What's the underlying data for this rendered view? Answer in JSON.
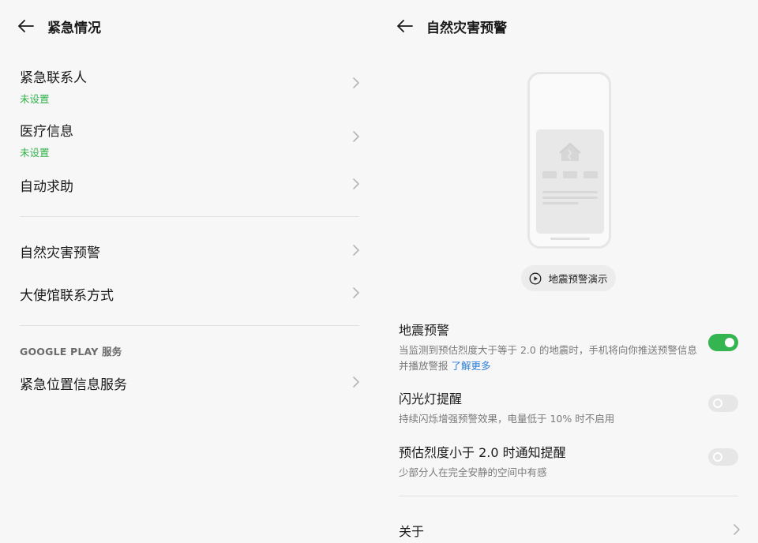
{
  "left": {
    "title": "紧急情况",
    "items": [
      {
        "label": "紧急联系人",
        "sub": "未设置"
      },
      {
        "label": "医疗信息",
        "sub": "未设置"
      },
      {
        "label": "自动求助"
      },
      {
        "label": "自然灾害预警"
      },
      {
        "label": "大使馆联系方式"
      },
      {
        "label": "紧急位置信息服务"
      }
    ],
    "section_google": "GOOGLE PLAY 服务"
  },
  "right": {
    "title": "自然灾害预警",
    "demo_label": "地震预警演示",
    "settings": [
      {
        "title": "地震预警",
        "desc": "当监测到预估烈度大于等于 2.0 的地震时，手机将向你推送预警信息并播放警报",
        "link": "了解更多",
        "on": true
      },
      {
        "title": "闪光灯提醒",
        "desc": "持续闪烁增强预警效果，电量低于 10% 时不启用",
        "on": false
      },
      {
        "title": "预估烈度小于 2.0 时通知提醒",
        "desc": "少部分人在完全安静的空间中有感",
        "on": false
      }
    ],
    "about_label": "关于"
  },
  "colors": {
    "accent_green": "#34b54f",
    "link_blue": "#2d7fd9",
    "sub_green": "#33b14b"
  },
  "icons": [
    "back-arrow-icon",
    "chevron-right-icon",
    "play-circle-icon",
    "house-warning-icon"
  ]
}
